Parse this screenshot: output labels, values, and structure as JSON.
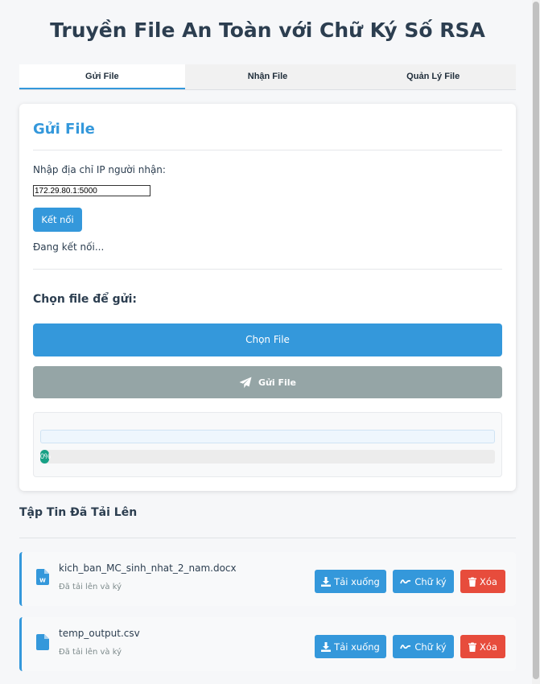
{
  "app": {
    "title": "Truyền File An Toàn với Chữ Ký Số RSA"
  },
  "tabs": [
    {
      "label": "Gửi File",
      "active": true
    },
    {
      "label": "Nhận File",
      "active": false
    },
    {
      "label": "Quản Lý File",
      "active": false
    }
  ],
  "send_panel": {
    "title": "Gửi File",
    "ip_label": "Nhập địa chỉ IP người nhận:",
    "ip_value": "172.29.80.1:5000",
    "connect_label": "Kết nối",
    "status": "Đang kết nối...",
    "choose_title": "Chọn file để gửi:",
    "choose_label": "Chọn File",
    "send_label": "Gửi File",
    "progress": {
      "percent": 0,
      "label": "0%"
    }
  },
  "uploaded": {
    "title": "Tập Tin Đã Tải Lên",
    "files": [
      {
        "name": "kich_ban_MC_sinh_nhat_2_nam.docx",
        "meta": "Đã tải lên và ký",
        "icon": "word-file-icon"
      },
      {
        "name": "temp_output.csv",
        "meta": "Đã tải lên và ký",
        "icon": "file-icon"
      }
    ],
    "actions": {
      "download": "Tải xuống",
      "sign": "Chữ ký",
      "delete": "Xóa"
    }
  },
  "colors": {
    "primary": "#3498db",
    "danger": "#e74c3c",
    "disabled": "#95a5a6",
    "progress": "#16a085",
    "text": "#2c3e50"
  }
}
